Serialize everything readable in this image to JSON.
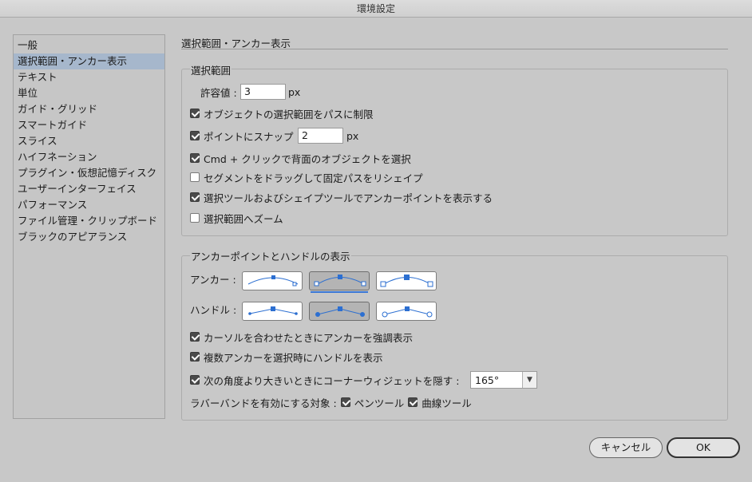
{
  "window": {
    "title": "環境設定"
  },
  "sidebar": {
    "items": [
      "一般",
      "選択範囲・アンカー表示",
      "テキスト",
      "単位",
      "ガイド・グリッド",
      "スマートガイド",
      "スライス",
      "ハイフネーション",
      "プラグイン・仮想記憶ディスク",
      "ユーザーインターフェイス",
      "パフォーマンス",
      "ファイル管理・クリップボード",
      "ブラックのアピアランス"
    ],
    "selected_index": 1
  },
  "panel": {
    "title": "選択範囲・アンカー表示",
    "selection": {
      "group_title": "選択範囲",
      "tolerance_label": "許容値 :",
      "tolerance_value": "3",
      "tolerance_unit": "px",
      "object_selection_by_path": {
        "label": "オブジェクトの選択範囲をパスに制限",
        "checked": true
      },
      "snap_to_point": {
        "label": "ポイントにスナップ",
        "checked": true,
        "value": "2",
        "unit": "px"
      },
      "cmd_click": {
        "label": "Cmd + クリックで背面のオブジェクトを選択",
        "checked": true
      },
      "drag_segment": {
        "label": "セグメントをドラッグして固定パスをリシェイプ",
        "checked": false
      },
      "show_anchor_points": {
        "label": "選択ツールおよびシェイプツールでアンカーポイントを表示する",
        "checked": true
      },
      "zoom_to_selection": {
        "label": "選択範囲へズーム",
        "checked": false
      }
    },
    "anchors_handles": {
      "group_title": "アンカーポイントとハンドルの表示",
      "anchor_label": "アンカー :",
      "anchor_selected_index": 1,
      "handle_label": "ハンドル :",
      "handle_selected_index": 1,
      "highlight_anchors": {
        "label": "カーソルを合わせたときにアンカーを強調表示",
        "checked": true
      },
      "show_handles_multi": {
        "label": "複数アンカーを選択時にハンドルを表示",
        "checked": true
      },
      "hide_corner_widget": {
        "label": "次の角度より大きいときにコーナーウィジェットを隠す :",
        "checked": true,
        "angle": "165°"
      },
      "rubber_band_label": "ラバーバンドを有効にする対象 :",
      "pen_tool": {
        "label": "ペンツール",
        "checked": true
      },
      "curvature_tool": {
        "label": "曲線ツール",
        "checked": true
      }
    }
  },
  "buttons": {
    "cancel": "キャンセル",
    "ok": "OK"
  },
  "colors": {
    "accent": "#3a77d6",
    "selection_bg": "#a6b7cc",
    "window_bg": "#c8c8c8"
  }
}
